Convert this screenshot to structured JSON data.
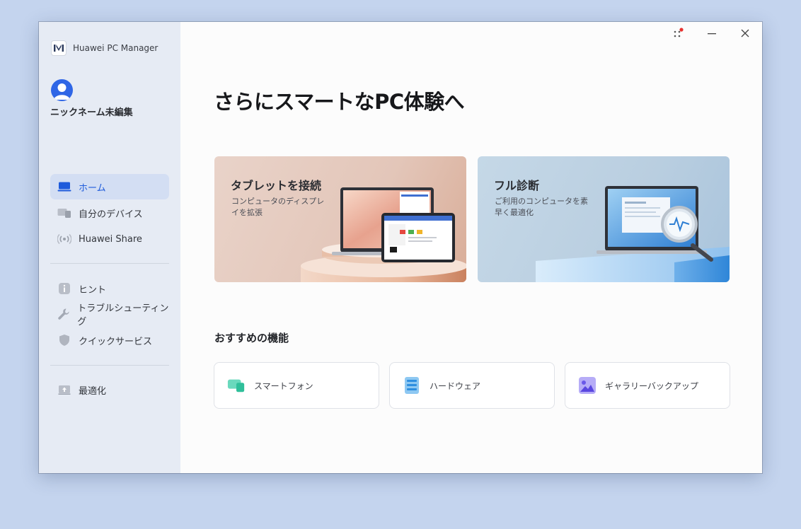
{
  "app": {
    "name": "Huawei PC Manager"
  },
  "profile": {
    "nickname": "ニックネーム未編集"
  },
  "sidebar": {
    "items": [
      {
        "label": "ホーム",
        "icon": "laptop-icon",
        "active": true
      },
      {
        "label": "自分のデバイス",
        "icon": "devices-icon"
      },
      {
        "label": "Huawei Share",
        "icon": "share-signal-icon"
      },
      {
        "label": "ヒント",
        "icon": "info-icon"
      },
      {
        "label": "トラブルシューティング",
        "icon": "wrench-icon"
      },
      {
        "label": "クイックサービス",
        "icon": "shield-icon"
      },
      {
        "label": "最適化",
        "icon": "optimize-icon"
      }
    ]
  },
  "titlebar": {
    "icons": [
      "apps-grid-icon",
      "minimize-icon",
      "close-icon"
    ],
    "notification_dot_color": "#e8322f"
  },
  "main": {
    "headline": "さらにスマートなPC体験へ",
    "cards": [
      {
        "title": "タブレットを接続",
        "description": "コンピュータのディスプレイを拡張"
      },
      {
        "title": "フル診断",
        "description": "ご利用のコンピュータを素早く最適化"
      }
    ],
    "recommended": {
      "title": "おすすめの機能",
      "items": [
        {
          "label": "スマートフォン",
          "icon": "smartphone-icon",
          "color": "#3ec9a7"
        },
        {
          "label": "ハードウェア",
          "icon": "hardware-icon",
          "color": "#4aa8e8"
        },
        {
          "label": "ギャラリーバックアップ",
          "icon": "gallery-icon",
          "color": "#7c6cf0"
        }
      ]
    }
  },
  "colors": {
    "accent": "#1e5bdb",
    "sidebar_bg": "#e6ebf4",
    "desktop_bg": "#c4d4ee"
  }
}
